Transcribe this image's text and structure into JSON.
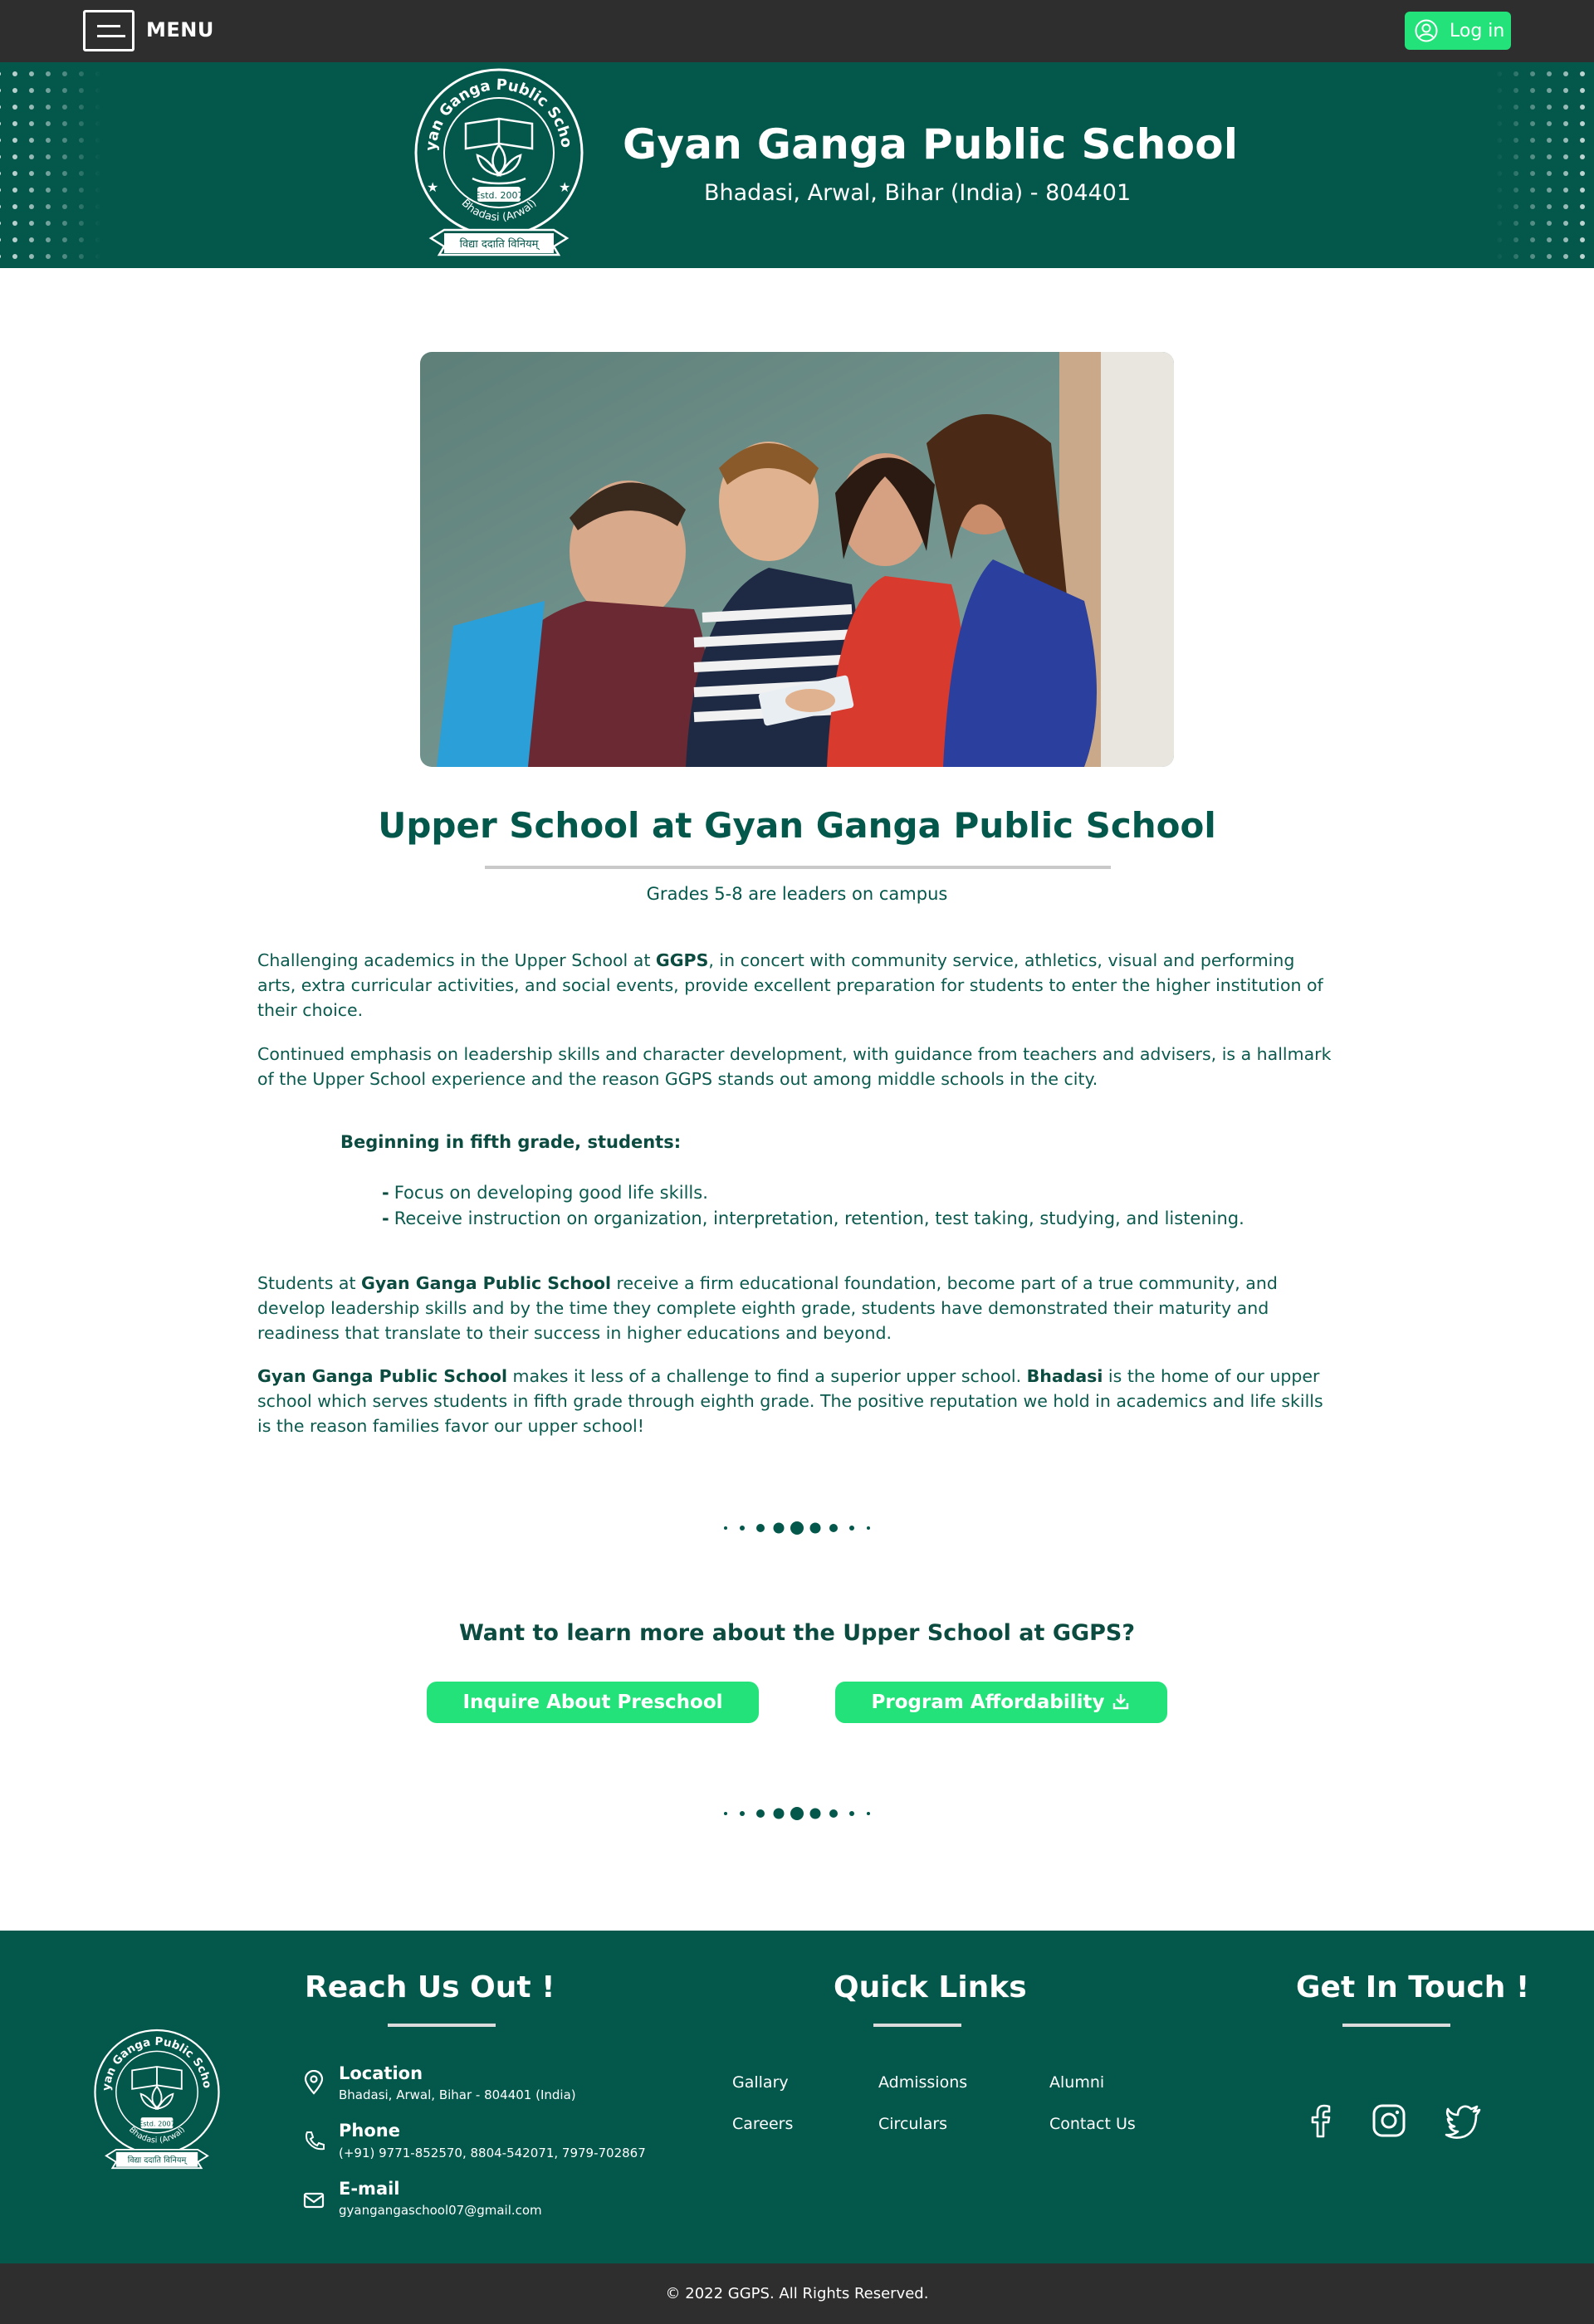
{
  "nav": {
    "menu_label": "MENU",
    "login_label": "Log in"
  },
  "header": {
    "school_name": "Gyan Ganga Public School",
    "address": "Bhadasi, Arwal, Bihar (India) - 804401",
    "logo": {
      "arc_text": "Gyan Ganga Public School",
      "estd": "Estd. 2007",
      "place": "Bhadasi (Arwal)",
      "motto": "विद्या ददाति विनियम्"
    }
  },
  "main": {
    "title": "Upper School at Gyan Ganga Public School",
    "subtitle": "Grades 5-8 are leaders on campus",
    "p1": {
      "a": "Challenging academics in the Upper School at ",
      "b": "GGPS",
      "c": ", in concert with community service, athletics, visual and performing arts, extra curricular activities, and social events, provide excellent preparation for students to enter the higher institution of their choice."
    },
    "p2": "Continued emphasis on leadership skills and character development, with guidance from teachers and advisers, is a hallmark of the Upper School experience and the reason GGPS stands out among middle schools in the city.",
    "list_heading": "Beginning in fifth grade, students:",
    "bullets": [
      "Focus on developing good life skills.",
      "Receive instruction on organization, interpretation, retention, test taking, studying, and listening."
    ],
    "bullet_mark": "-",
    "p3": {
      "a": "Students at ",
      "b": "Gyan Ganga Public School",
      "c": " receive a firm educational foundation, become part of a true community, and develop leadership skills and by the time they complete eighth grade, students have demonstrated their maturity and readiness that translate to their success in higher educations and beyond."
    },
    "p4": {
      "a": "Gyan Ganga Public School",
      "b": " makes it less of a challenge to find a superior upper school. ",
      "c": "Bhadasi",
      "d": " is the home of our upper school which serves students in fifth grade through eighth grade. The positive reputation we hold in academics and life skills is the reason families favor our upper school!"
    },
    "learn_more": "Want to learn more about the Upper School at GGPS?",
    "cta_inquire": "Inquire About Preschool",
    "cta_afford": "Program Affordability"
  },
  "footer": {
    "reach_title": "Reach Us Out !",
    "quick_title": "Quick Links",
    "touch_title": "Get In Touch !",
    "contacts": [
      {
        "title": "Location",
        "value": "Bhadasi, Arwal, Bihar - 804401 (India)",
        "icon": "location-pin-icon"
      },
      {
        "title": "Phone",
        "value": "(+91) 9771-852570, 8804-542071, 7979-702867",
        "icon": "phone-icon"
      },
      {
        "title": "E-mail",
        "value": "gyangangaschool07@gmail.com",
        "icon": "mail-icon"
      }
    ],
    "links": [
      "Gallary",
      "Admissions",
      "Alumni",
      "Careers",
      "Circulars",
      "Contact Us"
    ],
    "social": [
      "facebook-icon",
      "instagram-icon",
      "twitter-icon"
    ],
    "copyright": "© 2022 GGPS. All Rights Reserved."
  },
  "colors": {
    "primary": "#03574b",
    "accent": "#23e27a",
    "dark": "#2e2e2e"
  }
}
